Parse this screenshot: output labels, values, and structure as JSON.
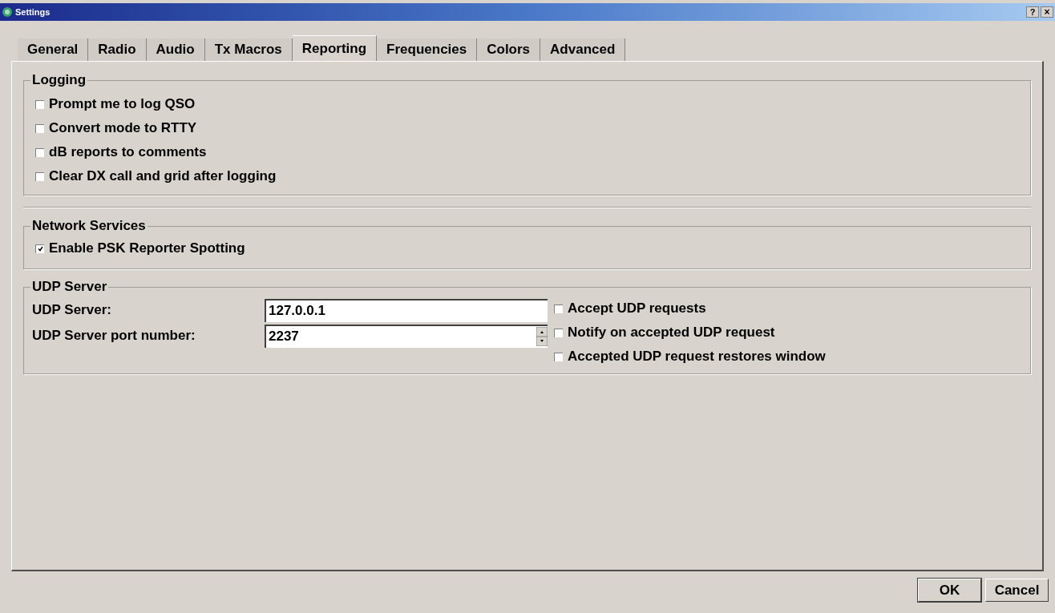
{
  "window": {
    "title": "Settings",
    "help_button": "?",
    "close_button": "×"
  },
  "tabs": [
    {
      "label": "General",
      "selected": false
    },
    {
      "label": "Radio",
      "selected": false
    },
    {
      "label": "Audio",
      "selected": false
    },
    {
      "label": "Tx Macros",
      "selected": false
    },
    {
      "label": "Reporting",
      "selected": true
    },
    {
      "label": "Frequencies",
      "selected": false
    },
    {
      "label": "Colors",
      "selected": false
    },
    {
      "label": "Advanced",
      "selected": false
    }
  ],
  "logging": {
    "title": "Logging",
    "options": [
      {
        "label": "Prompt me to log QSO",
        "checked": false
      },
      {
        "label": "Convert mode to RTTY",
        "checked": false
      },
      {
        "label": "dB reports to comments",
        "checked": false
      },
      {
        "label": "Clear DX call and grid after logging",
        "checked": false
      }
    ]
  },
  "network_services": {
    "title": "Network Services",
    "options": [
      {
        "label": "Enable PSK Reporter Spotting",
        "checked": true
      }
    ]
  },
  "udp_server": {
    "title": "UDP Server",
    "server_label": "UDP Server:",
    "server_value": "127.0.0.1",
    "port_label": "UDP Server port number:",
    "port_value": "2237",
    "options": [
      {
        "label": "Accept UDP requests",
        "checked": false
      },
      {
        "label": "Notify on accepted UDP request",
        "checked": false
      },
      {
        "label": "Accepted UDP request restores window",
        "checked": false
      }
    ]
  },
  "buttons": [
    {
      "label": "OK",
      "default": true
    },
    {
      "label": "Cancel",
      "default": false
    }
  ]
}
